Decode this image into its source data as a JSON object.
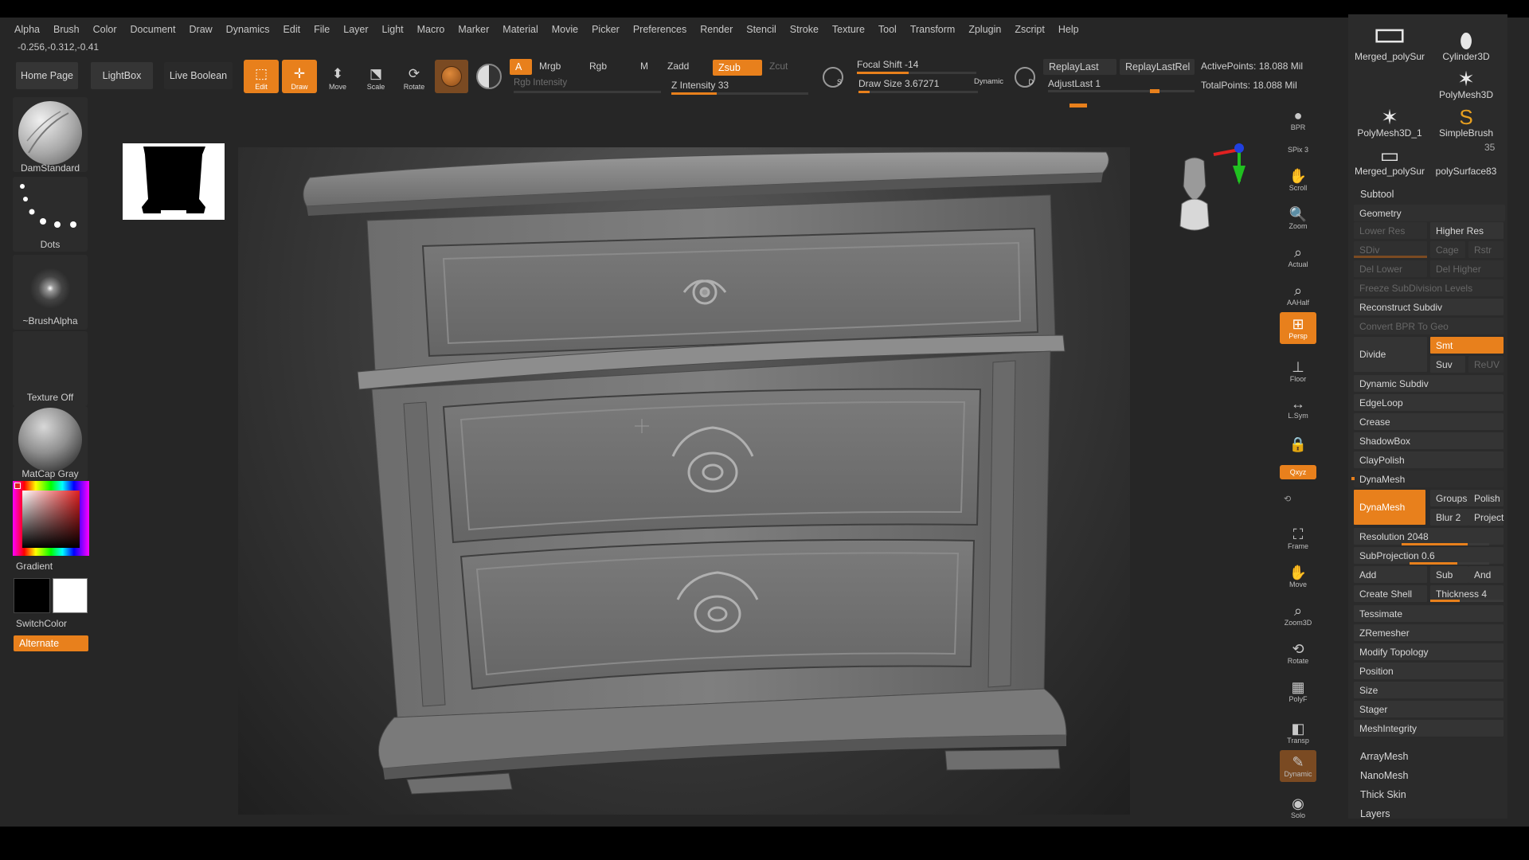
{
  "menu": [
    "Alpha",
    "Brush",
    "Color",
    "Document",
    "Draw",
    "Dynamics",
    "Edit",
    "File",
    "Layer",
    "Light",
    "Macro",
    "Marker",
    "Material",
    "Movie",
    "Picker",
    "Preferences",
    "Render",
    "Stencil",
    "Stroke",
    "Texture",
    "Tool",
    "Transform",
    "Zplugin",
    "Zscript",
    "Help"
  ],
  "coords": "-0.256,-0.312,-0.41",
  "shelf": {
    "home": "Home Page",
    "lightbox": "LightBox",
    "live_boolean": "Live Boolean"
  },
  "tools": {
    "edit": "Edit",
    "draw": "Draw",
    "move": "Move",
    "scale": "Scale",
    "rotate": "Rotate"
  },
  "modes": {
    "a": "A",
    "mrgb": "Mrgb",
    "rgb": "Rgb",
    "m": "M",
    "zadd": "Zadd",
    "zsub": "Zsub",
    "zcut": "Zcut"
  },
  "rgb_intensity": {
    "label": "Rgb Intensity"
  },
  "z_intensity": {
    "label": "Z Intensity 33",
    "value": 33
  },
  "focal_shift": {
    "label": "Focal Shift -14",
    "value": -14
  },
  "draw_size": {
    "label": "Draw Size 3.67271",
    "value": 3.67271
  },
  "dynamic": "Dynamic",
  "replay": {
    "last": "ReplayLast",
    "last_rel": "ReplayLastRel",
    "adjust_last": "AdjustLast 1"
  },
  "points": {
    "active": "ActivePoints: 18.088 Mil",
    "total": "TotalPoints: 18.088 Mil"
  },
  "left": {
    "brush": "DamStandard",
    "stroke": "Dots",
    "alpha": "~BrushAlpha",
    "texture": "Texture Off",
    "material": "MatCap Gray",
    "gradient": "Gradient",
    "switch_color": "SwitchColor",
    "alternate": "Alternate"
  },
  "right_tools": {
    "bpr": "BPR",
    "spix": "SPix 3",
    "scroll": "Scroll",
    "zoom": "Zoom",
    "actual": "Actual",
    "aahalf": "AAHalf",
    "persp": "Persp",
    "floor": "Floor",
    "lsym": "L.Sym",
    "lock": "",
    "xyz": "Qxyz",
    "frame": "Frame",
    "move": "Move",
    "zoom3d": "Zoom3D",
    "rotate": "Rotate",
    "polyf": "PolyF",
    "transp": "Transp",
    "solo": "Solo",
    "dynamic": "Dynamic"
  },
  "subtools": [
    {
      "name": "Merged_polySur"
    },
    {
      "name": "Cylinder3D"
    },
    {
      "name": "PolyMesh3D"
    },
    {
      "name": "PolyMesh3D_1"
    },
    {
      "name": "SimpleBrush"
    },
    {
      "name": "Merged_polySur"
    },
    {
      "name": "polySurface83"
    }
  ],
  "subtool_count": "35",
  "panel": {
    "subtool": "Subtool",
    "geometry": "Geometry",
    "lower_res": "Lower Res",
    "higher_res": "Higher Res",
    "sdiv": "SDiv",
    "cage": "Cage",
    "rstr": "Rstr",
    "del_lower": "Del Lower",
    "del_higher": "Del Higher",
    "freeze": "Freeze SubDivision Levels",
    "reconstruct": "Reconstruct Subdiv",
    "convert": "Convert BPR To Geo",
    "divide": "Divide",
    "smt": "Smt",
    "suv": "Suv",
    "reuv": "ReUV",
    "dynamic_subdiv": "Dynamic Subdiv",
    "edgeloop": "EdgeLoop",
    "crease": "Crease",
    "shadowbox": "ShadowBox",
    "claypolish": "ClayPolish",
    "dynamesh_header": "DynaMesh",
    "dynamesh_btn": "DynaMesh",
    "groups": "Groups",
    "polish": "Polish",
    "blur": "Blur 2",
    "project": "Project",
    "resolution": "Resolution 2048",
    "subprojection": "SubProjection 0.6",
    "add": "Add",
    "sub": "Sub",
    "and": "And",
    "create_shell": "Create Shell",
    "thickness": "Thickness 4",
    "tessimate": "Tessimate",
    "zremesher": "ZRemesher",
    "modify_topology": "Modify Topology",
    "position": "Position",
    "size": "Size",
    "stager": "Stager",
    "meshintegrity": "MeshIntegrity",
    "arraymesh": "ArrayMesh",
    "nanomesh": "NanoMesh",
    "thick_skin": "Thick Skin",
    "layers": "Layers"
  },
  "colors": {
    "accent": "#e8801c",
    "background": "#262626",
    "panel": "#2b2b2b"
  }
}
